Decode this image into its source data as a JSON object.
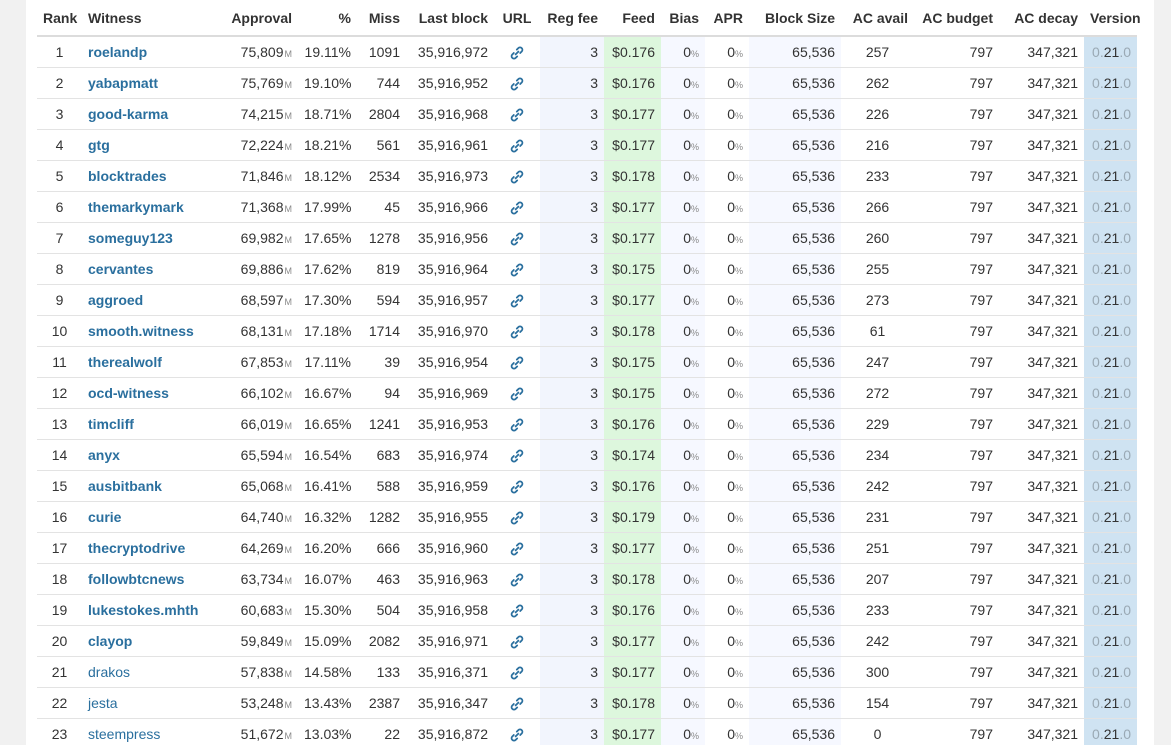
{
  "columns": [
    "Rank",
    "Witness",
    "Approval",
    "%",
    "Miss",
    "Last block",
    "URL",
    "Reg fee",
    "Feed",
    "Bias",
    "APR",
    "Block Size",
    "AC avail",
    "AC budget",
    "AC decay",
    "Version"
  ],
  "approval_unit": "M",
  "percent_unit": "%",
  "colors": {
    "link": "#2a6f9e",
    "feed_bg": "#ddf7dd",
    "version_bg": "#cfe3f2",
    "reg_bg": "#f2f5fd"
  },
  "url_icon": "link-icon",
  "rows": [
    {
      "rank": "1",
      "witness": "roelandp",
      "active": true,
      "approval": "75,809",
      "pct": "19.11%",
      "miss": "1091",
      "last_block": "35,916,972",
      "reg_fee": "3",
      "feed": "$0.176",
      "bias": "0",
      "apr": "0",
      "block_size": "65,536",
      "ac_avail": "257",
      "ac_budget": "797",
      "ac_decay": "347,321",
      "ver_pre": "0.",
      "ver_mid": "21",
      "ver_post": ".0"
    },
    {
      "rank": "2",
      "witness": "yabapmatt",
      "active": true,
      "approval": "75,769",
      "pct": "19.10%",
      "miss": "744",
      "last_block": "35,916,952",
      "reg_fee": "3",
      "feed": "$0.176",
      "bias": "0",
      "apr": "0",
      "block_size": "65,536",
      "ac_avail": "262",
      "ac_budget": "797",
      "ac_decay": "347,321",
      "ver_pre": "0.",
      "ver_mid": "21",
      "ver_post": ".0"
    },
    {
      "rank": "3",
      "witness": "good-karma",
      "active": true,
      "approval": "74,215",
      "pct": "18.71%",
      "miss": "2804",
      "last_block": "35,916,968",
      "reg_fee": "3",
      "feed": "$0.177",
      "bias": "0",
      "apr": "0",
      "block_size": "65,536",
      "ac_avail": "226",
      "ac_budget": "797",
      "ac_decay": "347,321",
      "ver_pre": "0.",
      "ver_mid": "21",
      "ver_post": ".0"
    },
    {
      "rank": "4",
      "witness": "gtg",
      "active": true,
      "approval": "72,224",
      "pct": "18.21%",
      "miss": "561",
      "last_block": "35,916,961",
      "reg_fee": "3",
      "feed": "$0.177",
      "bias": "0",
      "apr": "0",
      "block_size": "65,536",
      "ac_avail": "216",
      "ac_budget": "797",
      "ac_decay": "347,321",
      "ver_pre": "0.",
      "ver_mid": "21",
      "ver_post": ".0"
    },
    {
      "rank": "5",
      "witness": "blocktrades",
      "active": true,
      "approval": "71,846",
      "pct": "18.12%",
      "miss": "2534",
      "last_block": "35,916,973",
      "reg_fee": "3",
      "feed": "$0.178",
      "bias": "0",
      "apr": "0",
      "block_size": "65,536",
      "ac_avail": "233",
      "ac_budget": "797",
      "ac_decay": "347,321",
      "ver_pre": "0.",
      "ver_mid": "21",
      "ver_post": ".0"
    },
    {
      "rank": "6",
      "witness": "themarkymark",
      "active": true,
      "approval": "71,368",
      "pct": "17.99%",
      "miss": "45",
      "last_block": "35,916,966",
      "reg_fee": "3",
      "feed": "$0.177",
      "bias": "0",
      "apr": "0",
      "block_size": "65,536",
      "ac_avail": "266",
      "ac_budget": "797",
      "ac_decay": "347,321",
      "ver_pre": "0.",
      "ver_mid": "21",
      "ver_post": ".0"
    },
    {
      "rank": "7",
      "witness": "someguy123",
      "active": true,
      "approval": "69,982",
      "pct": "17.65%",
      "miss": "1278",
      "last_block": "35,916,956",
      "reg_fee": "3",
      "feed": "$0.177",
      "bias": "0",
      "apr": "0",
      "block_size": "65,536",
      "ac_avail": "260",
      "ac_budget": "797",
      "ac_decay": "347,321",
      "ver_pre": "0.",
      "ver_mid": "21",
      "ver_post": ".0"
    },
    {
      "rank": "8",
      "witness": "cervantes",
      "active": true,
      "approval": "69,886",
      "pct": "17.62%",
      "miss": "819",
      "last_block": "35,916,964",
      "reg_fee": "3",
      "feed": "$0.175",
      "bias": "0",
      "apr": "0",
      "block_size": "65,536",
      "ac_avail": "255",
      "ac_budget": "797",
      "ac_decay": "347,321",
      "ver_pre": "0.",
      "ver_mid": "21",
      "ver_post": ".0"
    },
    {
      "rank": "9",
      "witness": "aggroed",
      "active": true,
      "approval": "68,597",
      "pct": "17.30%",
      "miss": "594",
      "last_block": "35,916,957",
      "reg_fee": "3",
      "feed": "$0.177",
      "bias": "0",
      "apr": "0",
      "block_size": "65,536",
      "ac_avail": "273",
      "ac_budget": "797",
      "ac_decay": "347,321",
      "ver_pre": "0.",
      "ver_mid": "21",
      "ver_post": ".0"
    },
    {
      "rank": "10",
      "witness": "smooth.witness",
      "active": true,
      "approval": "68,131",
      "pct": "17.18%",
      "miss": "1714",
      "last_block": "35,916,970",
      "reg_fee": "3",
      "feed": "$0.178",
      "bias": "0",
      "apr": "0",
      "block_size": "65,536",
      "ac_avail": "61",
      "ac_budget": "797",
      "ac_decay": "347,321",
      "ver_pre": "0.",
      "ver_mid": "21",
      "ver_post": ".0"
    },
    {
      "rank": "11",
      "witness": "therealwolf",
      "active": true,
      "approval": "67,853",
      "pct": "17.11%",
      "miss": "39",
      "last_block": "35,916,954",
      "reg_fee": "3",
      "feed": "$0.175",
      "bias": "0",
      "apr": "0",
      "block_size": "65,536",
      "ac_avail": "247",
      "ac_budget": "797",
      "ac_decay": "347,321",
      "ver_pre": "0.",
      "ver_mid": "21",
      "ver_post": ".0"
    },
    {
      "rank": "12",
      "witness": "ocd-witness",
      "active": true,
      "approval": "66,102",
      "pct": "16.67%",
      "miss": "94",
      "last_block": "35,916,969",
      "reg_fee": "3",
      "feed": "$0.175",
      "bias": "0",
      "apr": "0",
      "block_size": "65,536",
      "ac_avail": "272",
      "ac_budget": "797",
      "ac_decay": "347,321",
      "ver_pre": "0.",
      "ver_mid": "21",
      "ver_post": ".0"
    },
    {
      "rank": "13",
      "witness": "timcliff",
      "active": true,
      "approval": "66,019",
      "pct": "16.65%",
      "miss": "1241",
      "last_block": "35,916,953",
      "reg_fee": "3",
      "feed": "$0.176",
      "bias": "0",
      "apr": "0",
      "block_size": "65,536",
      "ac_avail": "229",
      "ac_budget": "797",
      "ac_decay": "347,321",
      "ver_pre": "0.",
      "ver_mid": "21",
      "ver_post": ".0"
    },
    {
      "rank": "14",
      "witness": "anyx",
      "active": true,
      "approval": "65,594",
      "pct": "16.54%",
      "miss": "683",
      "last_block": "35,916,974",
      "reg_fee": "3",
      "feed": "$0.174",
      "bias": "0",
      "apr": "0",
      "block_size": "65,536",
      "ac_avail": "234",
      "ac_budget": "797",
      "ac_decay": "347,321",
      "ver_pre": "0.",
      "ver_mid": "21",
      "ver_post": ".0"
    },
    {
      "rank": "15",
      "witness": "ausbitbank",
      "active": true,
      "approval": "65,068",
      "pct": "16.41%",
      "miss": "588",
      "last_block": "35,916,959",
      "reg_fee": "3",
      "feed": "$0.176",
      "bias": "0",
      "apr": "0",
      "block_size": "65,536",
      "ac_avail": "242",
      "ac_budget": "797",
      "ac_decay": "347,321",
      "ver_pre": "0.",
      "ver_mid": "21",
      "ver_post": ".0"
    },
    {
      "rank": "16",
      "witness": "curie",
      "active": true,
      "approval": "64,740",
      "pct": "16.32%",
      "miss": "1282",
      "last_block": "35,916,955",
      "reg_fee": "3",
      "feed": "$0.179",
      "bias": "0",
      "apr": "0",
      "block_size": "65,536",
      "ac_avail": "231",
      "ac_budget": "797",
      "ac_decay": "347,321",
      "ver_pre": "0.",
      "ver_mid": "21",
      "ver_post": ".0"
    },
    {
      "rank": "17",
      "witness": "thecryptodrive",
      "active": true,
      "approval": "64,269",
      "pct": "16.20%",
      "miss": "666",
      "last_block": "35,916,960",
      "reg_fee": "3",
      "feed": "$0.177",
      "bias": "0",
      "apr": "0",
      "block_size": "65,536",
      "ac_avail": "251",
      "ac_budget": "797",
      "ac_decay": "347,321",
      "ver_pre": "0.",
      "ver_mid": "21",
      "ver_post": ".0"
    },
    {
      "rank": "18",
      "witness": "followbtcnews",
      "active": true,
      "approval": "63,734",
      "pct": "16.07%",
      "miss": "463",
      "last_block": "35,916,963",
      "reg_fee": "3",
      "feed": "$0.178",
      "bias": "0",
      "apr": "0",
      "block_size": "65,536",
      "ac_avail": "207",
      "ac_budget": "797",
      "ac_decay": "347,321",
      "ver_pre": "0.",
      "ver_mid": "21",
      "ver_post": ".0"
    },
    {
      "rank": "19",
      "witness": "lukestokes.mhth",
      "active": true,
      "approval": "60,683",
      "pct": "15.30%",
      "miss": "504",
      "last_block": "35,916,958",
      "reg_fee": "3",
      "feed": "$0.176",
      "bias": "0",
      "apr": "0",
      "block_size": "65,536",
      "ac_avail": "233",
      "ac_budget": "797",
      "ac_decay": "347,321",
      "ver_pre": "0.",
      "ver_mid": "21",
      "ver_post": ".0"
    },
    {
      "rank": "20",
      "witness": "clayop",
      "active": true,
      "approval": "59,849",
      "pct": "15.09%",
      "miss": "2082",
      "last_block": "35,916,971",
      "reg_fee": "3",
      "feed": "$0.177",
      "bias": "0",
      "apr": "0",
      "block_size": "65,536",
      "ac_avail": "242",
      "ac_budget": "797",
      "ac_decay": "347,321",
      "ver_pre": "0.",
      "ver_mid": "21",
      "ver_post": ".0"
    },
    {
      "rank": "21",
      "witness": "drakos",
      "active": false,
      "approval": "57,838",
      "pct": "14.58%",
      "miss": "133",
      "last_block": "35,916,371",
      "reg_fee": "3",
      "feed": "$0.177",
      "bias": "0",
      "apr": "0",
      "block_size": "65,536",
      "ac_avail": "300",
      "ac_budget": "797",
      "ac_decay": "347,321",
      "ver_pre": "0.",
      "ver_mid": "21",
      "ver_post": ".0"
    },
    {
      "rank": "22",
      "witness": "jesta",
      "active": false,
      "approval": "53,248",
      "pct": "13.43%",
      "miss": "2387",
      "last_block": "35,916,347",
      "reg_fee": "3",
      "feed": "$0.178",
      "bias": "0",
      "apr": "0",
      "block_size": "65,536",
      "ac_avail": "154",
      "ac_budget": "797",
      "ac_decay": "347,321",
      "ver_pre": "0.",
      "ver_mid": "21",
      "ver_post": ".0"
    },
    {
      "rank": "23",
      "witness": "steempress",
      "active": false,
      "approval": "51,672",
      "pct": "13.03%",
      "miss": "22",
      "last_block": "35,916,872",
      "reg_fee": "3",
      "feed": "$0.177",
      "bias": "0",
      "apr": "0",
      "block_size": "65,536",
      "ac_avail": "0",
      "ac_budget": "797",
      "ac_decay": "347,321",
      "ver_pre": "0.",
      "ver_mid": "21",
      "ver_post": ".0"
    }
  ]
}
